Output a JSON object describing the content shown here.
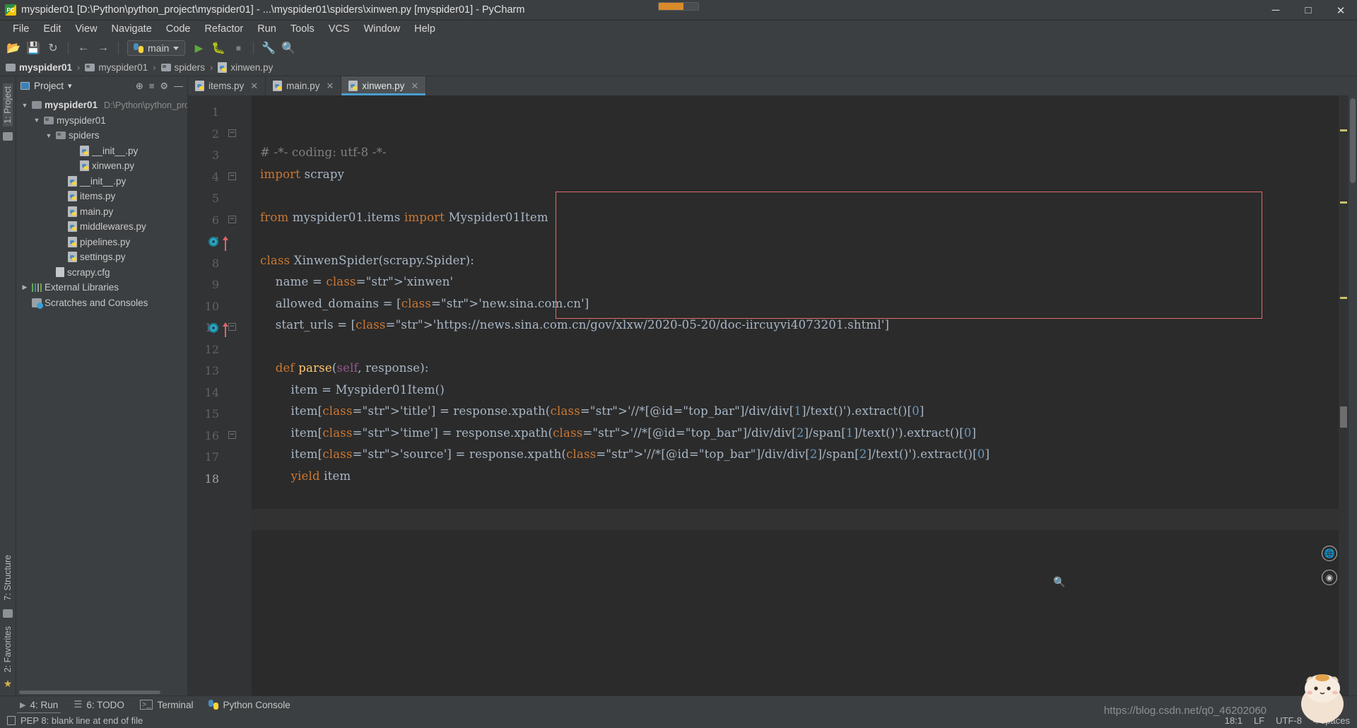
{
  "window": {
    "title": "myspider01 [D:\\Python\\python_project\\myspider01] - ...\\myspider01\\spiders\\xinwen.py [myspider01] - PyCharm",
    "icon": "pycharm-icon",
    "minimize": "─",
    "maximize": "□",
    "close": "✕"
  },
  "menu": {
    "items": [
      "File",
      "Edit",
      "View",
      "Navigate",
      "Code",
      "Refactor",
      "Run",
      "Tools",
      "VCS",
      "Window",
      "Help"
    ]
  },
  "toolbar": {
    "open_label": "📂",
    "save_label": "💾",
    "sync_label": "↻",
    "back_label": "←",
    "forward_label": "→",
    "run_config": "main",
    "run_label": "▶",
    "debug_label": "🐛",
    "stop_label": "■",
    "settings_label": "🔧",
    "search_label": "🔍"
  },
  "breadcrumb": {
    "items": [
      "myspider01",
      "myspider01",
      "spiders",
      "xinwen.py"
    ],
    "separator": "›"
  },
  "left_strip": {
    "project_label": "1: Project",
    "structure_label": "7: Structure",
    "favorites_label": "2: Favorites",
    "star": "★"
  },
  "project_panel": {
    "title": "Project",
    "dropdown": "▾",
    "action_target": "⊕",
    "action_collapse": "≡",
    "action_settings": "⚙",
    "action_hide": "—",
    "tree": [
      {
        "label": "myspider01",
        "path": "D:\\Python\\python_pro",
        "icon": "folder-icon",
        "arrow": "▼",
        "indent": 0,
        "bold": true
      },
      {
        "label": "myspider01",
        "path": "",
        "icon": "source-folder-icon",
        "arrow": "▼",
        "indent": 1,
        "bold": false
      },
      {
        "label": "spiders",
        "path": "",
        "icon": "source-folder-icon",
        "arrow": "▼",
        "indent": 2,
        "bold": false
      },
      {
        "label": "__init__.py",
        "path": "",
        "icon": "python-file-icon",
        "arrow": "",
        "indent": 4,
        "bold": false
      },
      {
        "label": "xinwen.py",
        "path": "",
        "icon": "python-file-icon",
        "arrow": "",
        "indent": 4,
        "bold": false
      },
      {
        "label": "__init__.py",
        "path": "",
        "icon": "python-file-icon",
        "arrow": "",
        "indent": 3,
        "bold": false
      },
      {
        "label": "items.py",
        "path": "",
        "icon": "python-file-icon",
        "arrow": "",
        "indent": 3,
        "bold": false
      },
      {
        "label": "main.py",
        "path": "",
        "icon": "python-file-icon",
        "arrow": "",
        "indent": 3,
        "bold": false
      },
      {
        "label": "middlewares.py",
        "path": "",
        "icon": "python-file-icon",
        "arrow": "",
        "indent": 3,
        "bold": false
      },
      {
        "label": "pipelines.py",
        "path": "",
        "icon": "python-file-icon",
        "arrow": "",
        "indent": 3,
        "bold": false
      },
      {
        "label": "settings.py",
        "path": "",
        "icon": "python-file-icon",
        "arrow": "",
        "indent": 3,
        "bold": false
      },
      {
        "label": "scrapy.cfg",
        "path": "",
        "icon": "config-file-icon",
        "arrow": "",
        "indent": 2,
        "bold": false
      },
      {
        "label": "External Libraries",
        "path": "",
        "icon": "library-icon",
        "arrow": "▶",
        "indent": 0,
        "bold": false
      },
      {
        "label": "Scratches and Consoles",
        "path": "",
        "icon": "scratches-icon",
        "arrow": "",
        "indent": 0,
        "bold": false
      }
    ]
  },
  "tabs": [
    {
      "label": "items.py",
      "active": false,
      "close": "✕"
    },
    {
      "label": "main.py",
      "active": false,
      "close": "✕"
    },
    {
      "label": "xinwen.py",
      "active": true,
      "close": "✕"
    }
  ],
  "editor": {
    "line_numbers": [
      "1",
      "2",
      "3",
      "4",
      "5",
      "6",
      "7",
      "8",
      "9",
      "10",
      "11",
      "12",
      "13",
      "14",
      "15",
      "16",
      "17",
      "18"
    ],
    "current_line": "18",
    "code_lines": [
      "# -*- coding: utf-8 -*-",
      "import scrapy",
      "",
      "from myspider01.items import Myspider01Item",
      "",
      "class XinwenSpider(scrapy.Spider):",
      "    name = 'xinwen'",
      "    allowed_domains = ['new.sina.com.cn']",
      "    start_urls = ['https://news.sina.com.cn/gov/xlxw/2020-05-20/doc-iircuyvi4073201.shtml']",
      "",
      "    def parse(self, response):",
      "        item = Myspider01Item()",
      "        item['title'] = response.xpath('//*[@id=\"top_bar\"]/div/div[1]/text()').extract()[0]",
      "        item['time'] = response.xpath('//*[@id=\"top_bar\"]/div/div[2]/span[1]/text()').extract()[0]",
      "        item['source'] = response.xpath('//*[@id=\"top_bar\"]/div/div[2]/span[2]/text()').extract()[0]",
      "        yield item",
      "",
      ""
    ],
    "highlight_box_color": "#e06c6c"
  },
  "tool_windows": [
    {
      "label": "4: Run",
      "icon": "run-icon",
      "active": true
    },
    {
      "label": "6: TODO",
      "icon": "todo-icon",
      "active": false
    },
    {
      "label": "Terminal",
      "icon": "terminal-icon",
      "active": false
    },
    {
      "label": "Python Console",
      "icon": "python-console-icon",
      "active": false
    }
  ],
  "status_bar": {
    "message": "PEP 8: blank line at end of file",
    "caret_position": "18:1",
    "line_separator": "LF",
    "encoding": "UTF-8",
    "indent": "4 spaces",
    "watermark": "https://blog.csdn.net/q0_46202060"
  },
  "colors": {
    "accent": "#4a9ecf",
    "keyword": "#cc7832",
    "string": "#6a8759",
    "function": "#ffc66d",
    "number": "#6897bb",
    "comment": "#808080",
    "error_box": "#e06c6c",
    "bg_editor": "#2b2b2b",
    "bg_chrome": "#3c3f41"
  }
}
